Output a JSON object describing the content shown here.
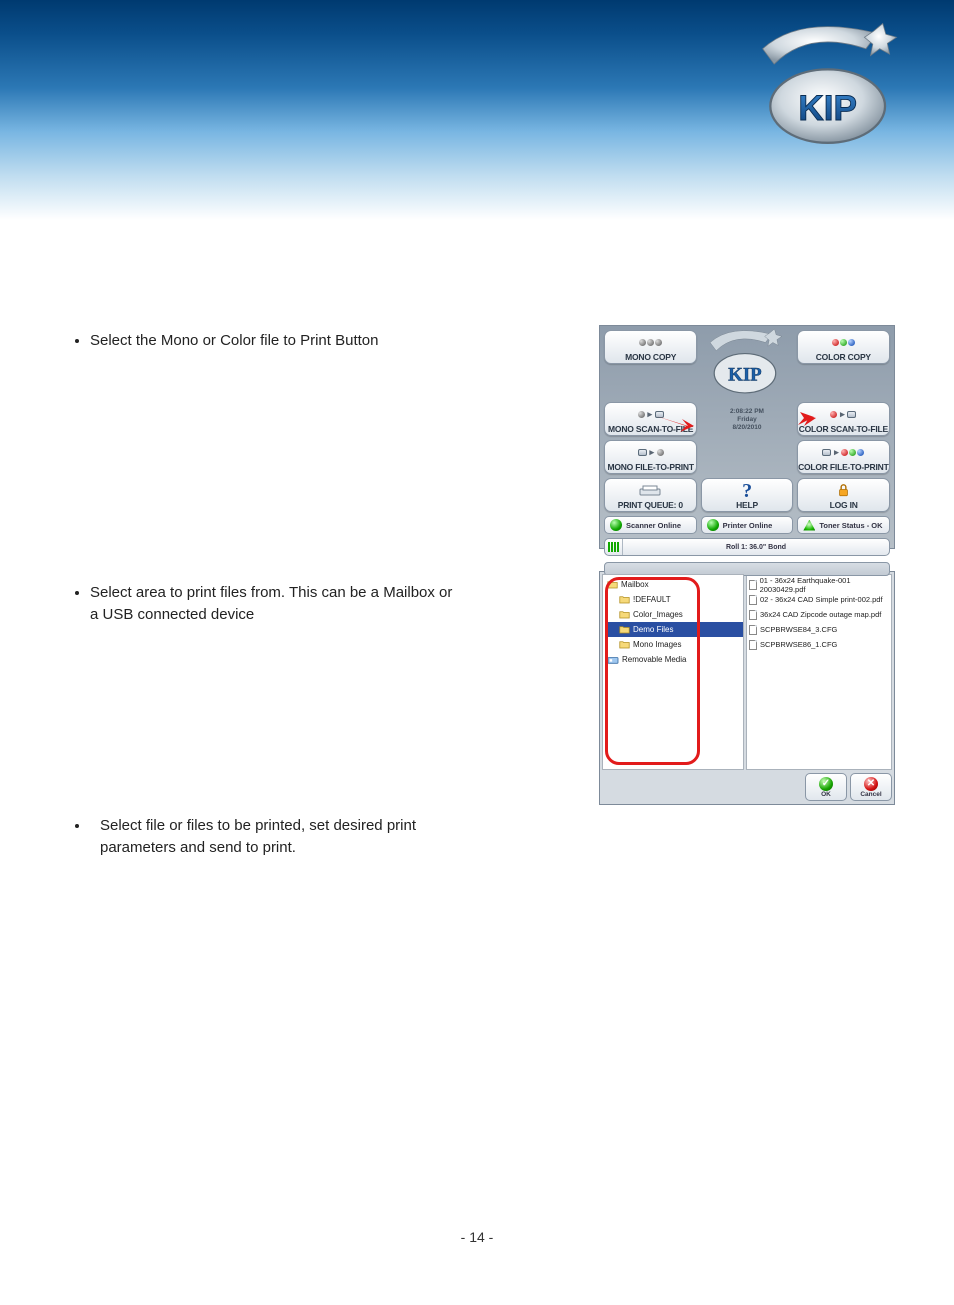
{
  "page_number": "- 14 -",
  "bullets": [
    "Select the Mono or Color file to Print Button",
    "Select area to print files from. This can be a Mailbox or a USB connected device",
    "Select file or files to be printed, set desired print parameters and send to print."
  ],
  "shot1": {
    "buttons": {
      "mono_copy": "MONO COPY",
      "color_copy": "COLOR COPY",
      "mono_scan": "MONO SCAN-TO-FILE",
      "color_scan": "COLOR SCAN-TO-FILE",
      "mono_f2p": "MONO FILE-TO-PRINT",
      "color_f2p": "COLOR FILE-TO-PRINT",
      "print_queue": "PRINT QUEUE: 0",
      "help": "HELP",
      "login": "LOG IN"
    },
    "datetime": {
      "time": "2:08:22 PM",
      "day": "Friday",
      "date": "8/20/2010"
    },
    "status": {
      "scanner": "Scanner Online",
      "printer": "Printer Online",
      "toner": "Toner Status - OK"
    },
    "roll": "Roll 1: 36.0\" Bond"
  },
  "shot2": {
    "tree": [
      {
        "label": "Mailbox",
        "depth": 0,
        "icon": "folder"
      },
      {
        "label": "!DEFAULT",
        "depth": 1,
        "icon": "folder"
      },
      {
        "label": "Color_Images",
        "depth": 1,
        "icon": "folder"
      },
      {
        "label": "Demo Files",
        "depth": 1,
        "icon": "folder",
        "selected": true
      },
      {
        "label": "Mono Images",
        "depth": 1,
        "icon": "folder"
      },
      {
        "label": "Removable Media",
        "depth": 0,
        "icon": "drive"
      }
    ],
    "files": [
      "01 - 36x24 Earthquake-001 20030429.pdf",
      "02 - 36x24 CAD Simple print-002.pdf",
      "36x24 CAD Zipcode outage map.pdf",
      "SCPBRWSE84_3.CFG",
      "SCPBRWSE86_1.CFG"
    ],
    "ok": "OK",
    "cancel": "Cancel"
  }
}
